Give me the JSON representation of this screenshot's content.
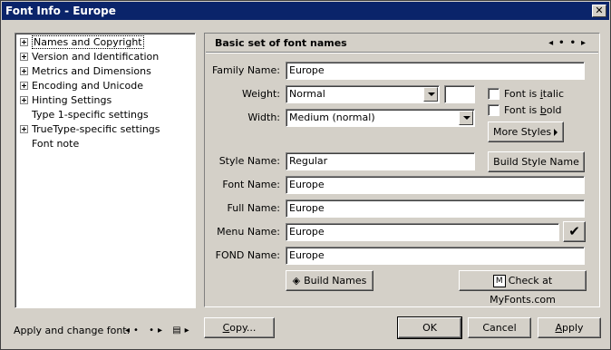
{
  "window": {
    "title": "Font Info - Europe",
    "close_glyph": "✕"
  },
  "tree": {
    "items": [
      {
        "label": "Names and Copyright",
        "expandable": true,
        "selected": true
      },
      {
        "label": "Version and Identification",
        "expandable": true
      },
      {
        "label": "Metrics and Dimensions",
        "expandable": true
      },
      {
        "label": "Encoding and Unicode",
        "expandable": true
      },
      {
        "label": "Hinting Settings",
        "expandable": true
      },
      {
        "label": "Type 1-specific settings",
        "expandable": false
      },
      {
        "label": "TrueType-specific settings",
        "expandable": true
      },
      {
        "label": "Font note",
        "expandable": false
      }
    ]
  },
  "panel": {
    "title": "Basic set of font names",
    "nav_prev": "◂•",
    "nav_next": "•▸"
  },
  "form": {
    "family_name_label": "Family Name:",
    "family_name_value": "Europe",
    "weight_label": "Weight:",
    "weight_value": "Normal",
    "weight_number": "",
    "width_label": "Width:",
    "width_value": "Medium (normal)",
    "italic_pre": "Font is ",
    "italic_mn": "i",
    "italic_post": "talic",
    "bold_pre": "Font is ",
    "bold_mn": "b",
    "bold_post": "old",
    "more_styles": "More Styles",
    "style_name_label": "Style Name:",
    "style_name_value": "Regular",
    "build_style_name": "Build Style Name",
    "font_name_label": "Font Name:",
    "font_name_value": "Europe",
    "full_name_label": "Full Name:",
    "full_name_value": "Europe",
    "menu_name_label": "Menu Name:",
    "menu_name_value": "Europe",
    "fond_name_label": "FOND Name:",
    "fond_name_value": "Europe",
    "build_names": "Build Names",
    "check_myfonts": "Check at MyFonts.com"
  },
  "footer": {
    "apply_change_label": "Apply and change font:",
    "copy_pre": "",
    "copy_mn": "C",
    "copy_post": "opy...",
    "ok": "OK",
    "cancel": "Cancel",
    "apply_mn": "A",
    "apply_post": "pply"
  }
}
